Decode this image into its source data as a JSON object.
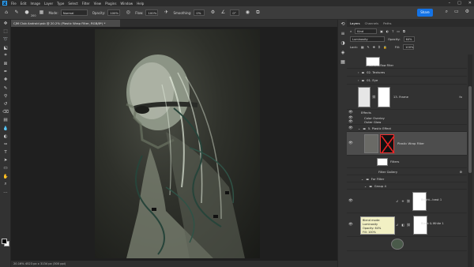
{
  "menubar": {
    "logo": "Ps",
    "items": [
      "File",
      "Edit",
      "Image",
      "Layer",
      "Type",
      "Select",
      "Filter",
      "View",
      "Plugins",
      "Window",
      "Help"
    ]
  },
  "options": {
    "brush_size": "200",
    "mode_label": "Mode:",
    "mode_value": "Normal",
    "opacity_label": "Opacity:",
    "opacity_value": "100%",
    "flow_label": "Flow:",
    "flow_value": "100%",
    "smoothing_label": "Smoothing:",
    "smoothing_value": "0%",
    "angle_value": "0°",
    "share_label": "Share"
  },
  "document": {
    "tab_title": "CJM Club Android.psb @ 20.2% (Plastic Wrap Filter, RGB/8*) *",
    "status_text": "20.16%    4523 px x 3134 px (300 ppi)"
  },
  "panel": {
    "tabs": [
      "Layers",
      "Channels",
      "Paths"
    ],
    "filter_kind": "Kind",
    "blend_mode": "Luminosity",
    "opacity_label": "Opacity:",
    "opacity_value": "64%",
    "lock_label": "Lock:",
    "fill_label": "Fill:",
    "fill_value": "100%"
  },
  "layers": [
    {
      "name": "Camera Raw Filter"
    },
    {
      "name": "02. Textures"
    },
    {
      "name": "01. Eye"
    },
    {
      "name": "13. Frame"
    },
    {
      "name": "Effects"
    },
    {
      "name": "Color Overlay"
    },
    {
      "name": "Outer Glow"
    },
    {
      "name": "5. Plastic Effect"
    },
    {
      "name": "Plastic Wrap Filter"
    },
    {
      "name": "Filters"
    },
    {
      "name": "Filter Gallery"
    },
    {
      "name": "For Filter"
    },
    {
      "name": "Group 4"
    },
    {
      "name": "Bright...trast 1"
    },
    {
      "name": "Black & White 1"
    }
  ],
  "tooltip": {
    "line1": "Blend mode: Luminosity",
    "line2": "Opacity: 64%",
    "line3": "Fill: 100%"
  }
}
